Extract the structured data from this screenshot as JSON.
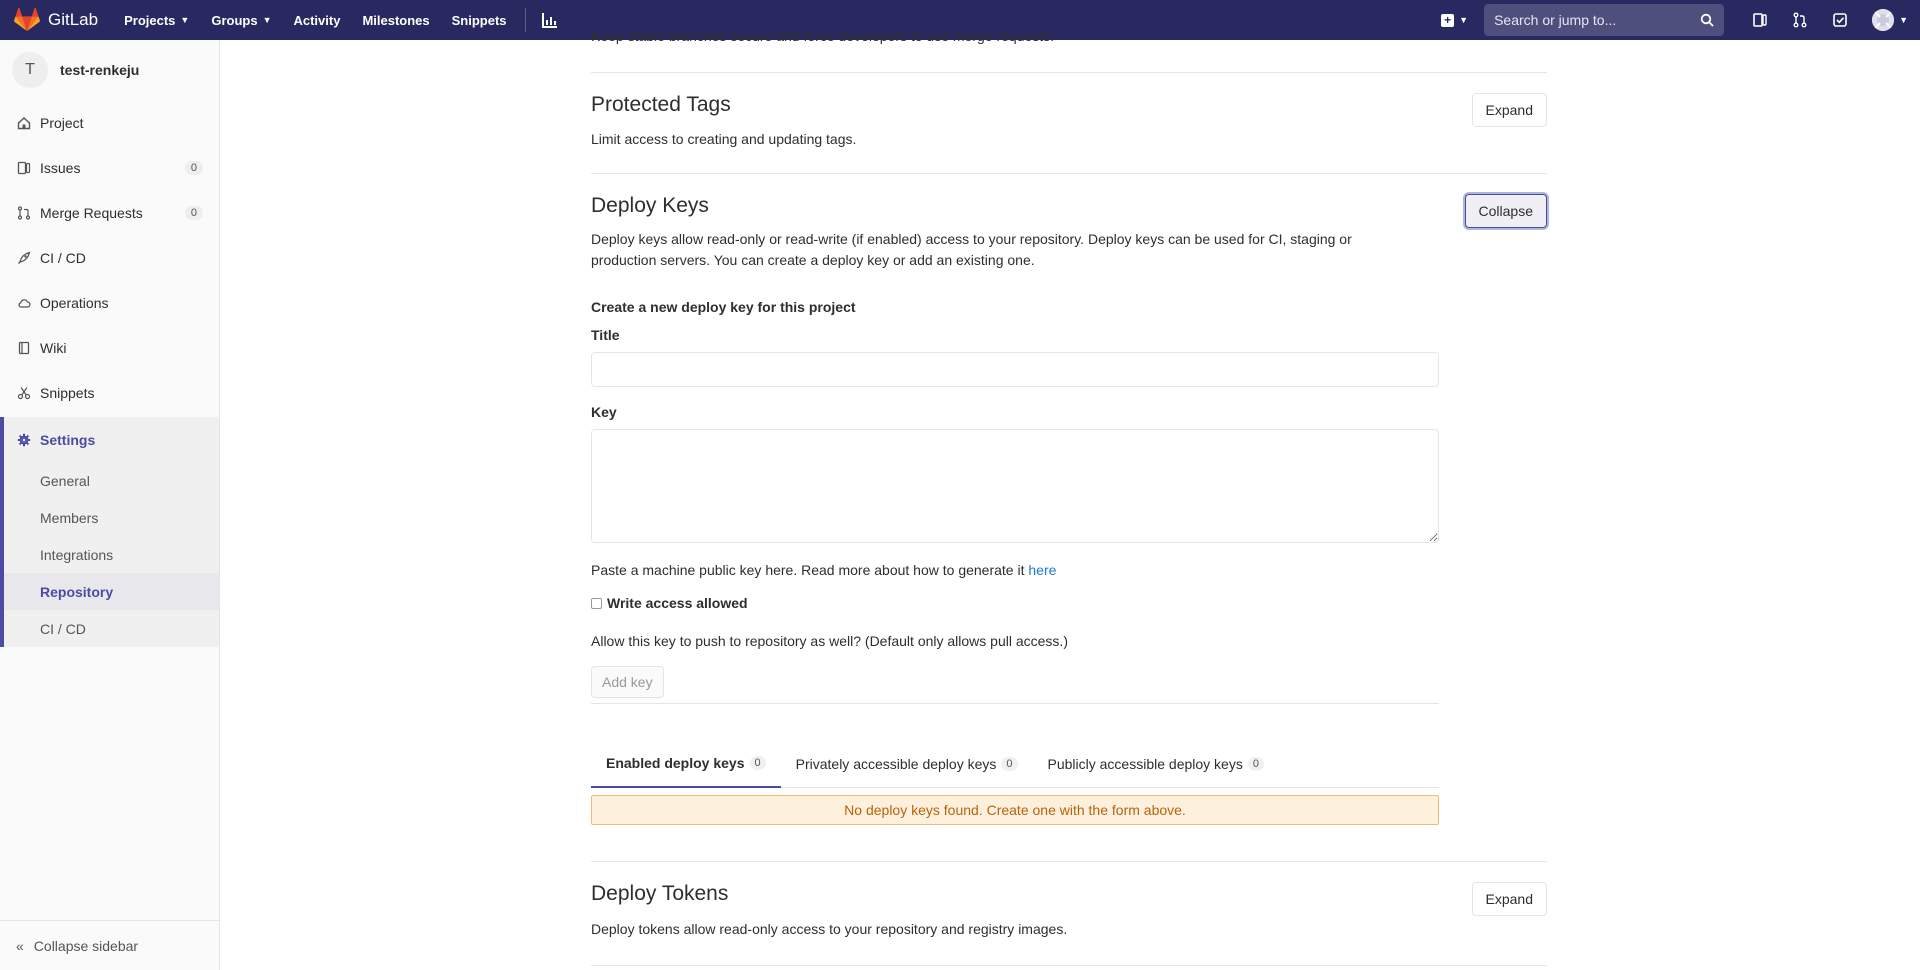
{
  "topbar": {
    "brand": "GitLab",
    "nav": [
      "Projects",
      "Groups",
      "Activity",
      "Milestones",
      "Snippets"
    ],
    "search_placeholder": "Search or jump to..."
  },
  "sidebar": {
    "project_initial": "T",
    "project_name": "test-renkeju",
    "items": [
      {
        "label": "Project",
        "icon": "home-icon"
      },
      {
        "label": "Issues",
        "icon": "issues-icon",
        "count": "0"
      },
      {
        "label": "Merge Requests",
        "icon": "merge-request-icon",
        "count": "0"
      },
      {
        "label": "CI / CD",
        "icon": "rocket-icon"
      },
      {
        "label": "Operations",
        "icon": "cloud-icon"
      },
      {
        "label": "Wiki",
        "icon": "book-icon"
      },
      {
        "label": "Snippets",
        "icon": "scissors-icon"
      }
    ],
    "settings_label": "Settings",
    "settings_sub": [
      "General",
      "Members",
      "Integrations",
      "Repository",
      "CI / CD"
    ],
    "collapse_label": "Collapse sidebar"
  },
  "content": {
    "cut_text": "Keep stable branches secure and force developers to use merge requests.",
    "protected_tags": {
      "title": "Protected Tags",
      "desc": "Limit access to creating and updating tags.",
      "button": "Expand"
    },
    "deploy_keys": {
      "title": "Deploy Keys",
      "desc_line1": "Deploy keys allow read-only or read-write (if enabled) access to your repository. Deploy keys can be used for CI, staging or",
      "desc_line2": "production servers. You can create a deploy key or add an existing one.",
      "button": "Collapse",
      "form_heading": "Create a new deploy key for this project",
      "title_label": "Title",
      "key_label": "Key",
      "help_text": "Paste a machine public key here. Read more about how to generate it ",
      "help_link": "here",
      "write_label": "Write access allowed",
      "write_help": "Allow this key to push to repository as well? (Default only allows pull access.)",
      "add_button": "Add key",
      "tabs": [
        {
          "label": "Enabled deploy keys",
          "count": "0"
        },
        {
          "label": "Privately accessible deploy keys",
          "count": "0"
        },
        {
          "label": "Publicly accessible deploy keys",
          "count": "0"
        }
      ],
      "empty_message": "No deploy keys found. Create one with the form above."
    },
    "deploy_tokens": {
      "title": "Deploy Tokens",
      "desc": "Deploy tokens allow read-only access to your repository and registry images.",
      "button": "Expand"
    }
  }
}
